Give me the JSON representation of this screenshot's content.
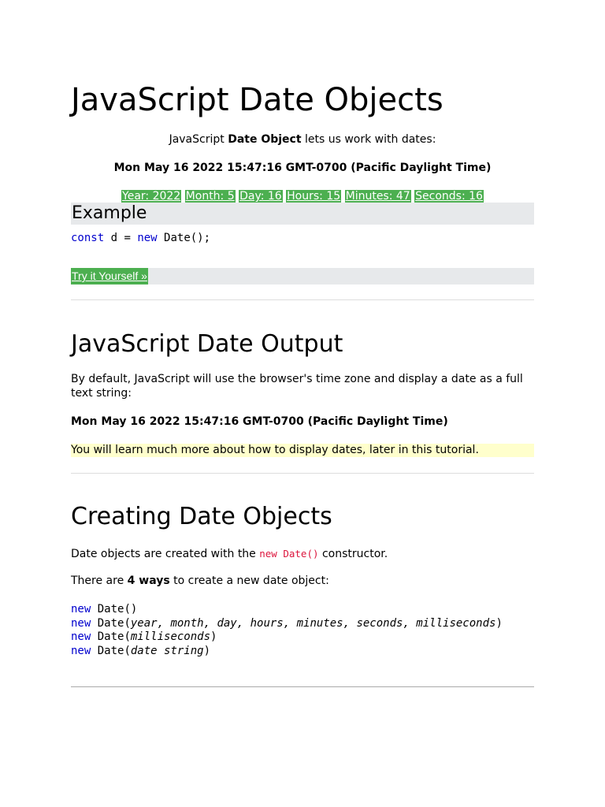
{
  "page": {
    "title": "JavaScript Date Objects",
    "intro": {
      "prefix": "JavaScript ",
      "bold": "Date Object",
      "suffix": " lets us work with dates:"
    },
    "current_date": "Mon May 16 2022 15:47:16 GMT-0700 (Pacific Daylight Time)",
    "date_parts": [
      "Year: 2022",
      "Month: 5",
      "Day: 16",
      "Hours: 15",
      "Minutes: 47",
      "Seconds: 16"
    ]
  },
  "example": {
    "heading": "Example",
    "code": {
      "kw1": "const",
      "mid": " d = ",
      "kw2": "new",
      "rest": " Date();"
    },
    "try_button": "Try it Yourself »"
  },
  "output_section": {
    "heading": "JavaScript Date Output",
    "paragraph": "By default, JavaScript will use the browser's time zone and display a date as a full text string:",
    "date_string": "Mon May 16 2022 15:47:16 GMT-0700 (Pacific Daylight Time)",
    "note": "You will learn much more about how to display dates, later in this tutorial."
  },
  "creating_section": {
    "heading": "Creating Date Objects",
    "constructor_line": {
      "prefix": "Date objects are created with the ",
      "code": "new Date()",
      "suffix": " constructor."
    },
    "ways_line": {
      "prefix": "There are ",
      "bold": "4 ways",
      "suffix": " to create a new date object:"
    },
    "syntax": [
      {
        "kw": "new",
        "call": " Date(",
        "args": "",
        "close": ")"
      },
      {
        "kw": "new",
        "call": " Date(",
        "args": "year, month, day, hours, minutes, seconds, milliseconds",
        "close": ")"
      },
      {
        "kw": "new",
        "call": " Date(",
        "args": "milliseconds",
        "close": ")"
      },
      {
        "kw": "new",
        "call": " Date(",
        "args": "date string",
        "close": ")"
      }
    ]
  },
  "colors": {
    "green": "#4caf50",
    "example_bg": "#e7e9eb",
    "note_bg": "#ffffcc",
    "keyword": "#0000cd",
    "inline_code": "#dc143c"
  }
}
